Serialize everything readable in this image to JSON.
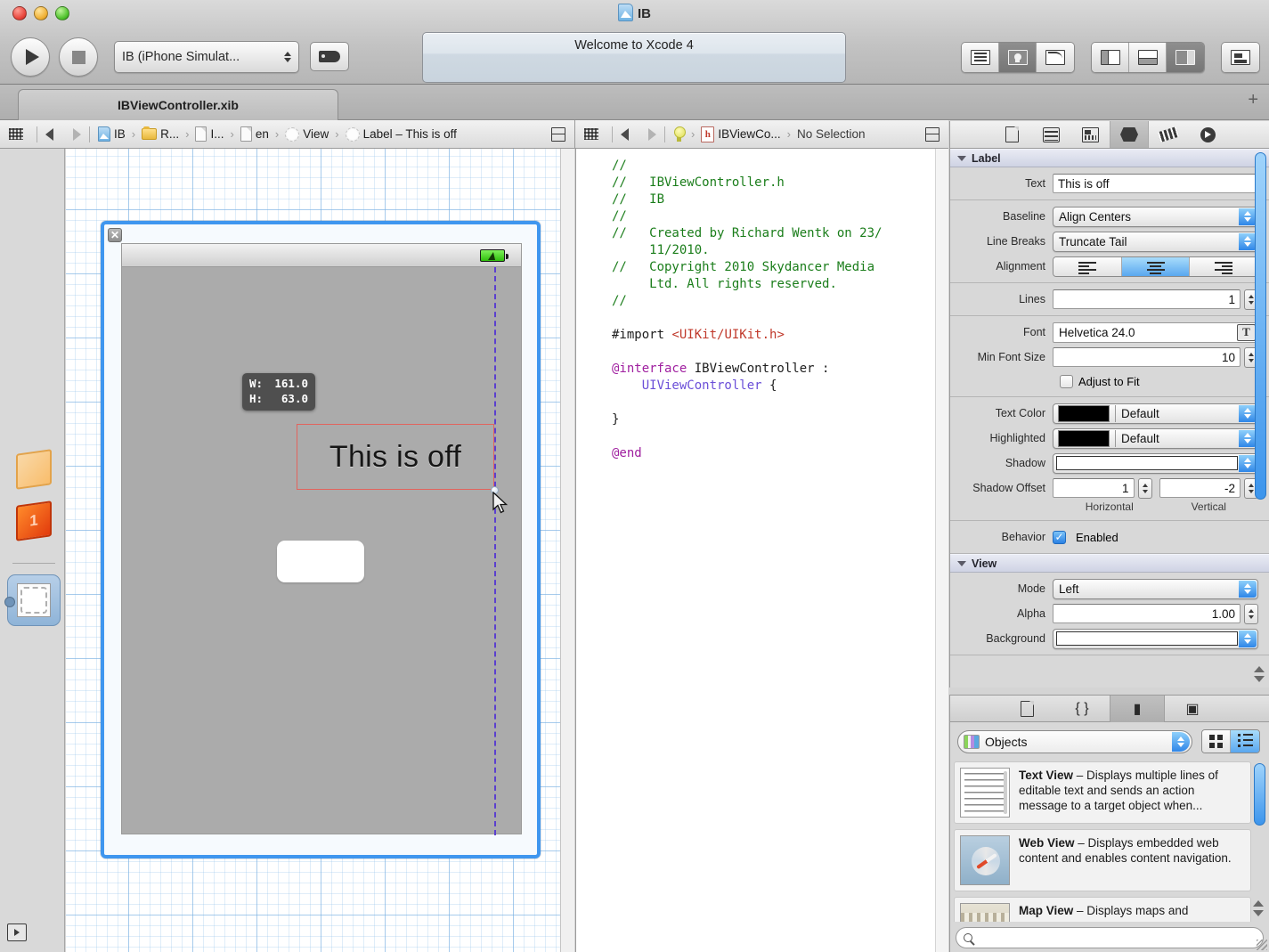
{
  "window": {
    "title": "IB",
    "title_icon": "xcode-project-icon",
    "traffic_lights": [
      "close",
      "minimize",
      "zoom"
    ]
  },
  "toolbar": {
    "run_button": "run-icon",
    "stop_button": "stop-icon",
    "scheme": "IB (iPhone Simulat...",
    "breakpoint_button": "breakpoint-icon",
    "status": "Welcome to Xcode 4",
    "editor_segments": [
      {
        "name": "standard-editor",
        "icon": "lines-icon",
        "selected": false
      },
      {
        "name": "assistant-editor",
        "icon": "bulb-icon",
        "selected": true
      },
      {
        "name": "version-editor",
        "icon": "curve-icon",
        "selected": false
      }
    ],
    "view_segments": [
      {
        "name": "navigator-toggle",
        "icon": "left-pane-icon",
        "selected": false
      },
      {
        "name": "debug-toggle",
        "icon": "bottom-pane-icon",
        "selected": false
      },
      {
        "name": "utilities-toggle",
        "icon": "right-pane-icon",
        "selected": true
      }
    ],
    "organizer_button": "organizer-icon"
  },
  "tabbar": {
    "tab_label": "IBViewController.xib",
    "add_tab": "+"
  },
  "jumpbar_left": {
    "crumbs": [
      {
        "label": "IB",
        "icon": "project-icon"
      },
      {
        "label": "R...",
        "icon": "folder-icon"
      },
      {
        "label": "I...",
        "icon": "file-icon"
      },
      {
        "label": "en",
        "icon": "file-icon"
      },
      {
        "label": "View",
        "icon": "object-icon"
      },
      {
        "label": "Label – This is off",
        "icon": "object-icon"
      }
    ]
  },
  "jumpbar_mid": {
    "crumbs": [
      {
        "label": "",
        "icon": "bulb-icon"
      },
      {
        "label": "IBViewCo...",
        "icon": "header-file-icon"
      },
      {
        "label": "No Selection",
        "icon": ""
      }
    ]
  },
  "canvas": {
    "size_tooltip": {
      "w_key": "W:",
      "w_value": "161.0",
      "h_key": "H:",
      "h_value": "63.0"
    },
    "label_text": "This is off",
    "close_glyph": "✕",
    "battery_icon": "battery-charging-icon"
  },
  "editor": {
    "lines": [
      [
        {
          "t": "//",
          "c": "comment"
        }
      ],
      [
        {
          "t": "//   IBViewController.h",
          "c": "comment"
        }
      ],
      [
        {
          "t": "//   IB",
          "c": "comment"
        }
      ],
      [
        {
          "t": "//",
          "c": "comment"
        }
      ],
      [
        {
          "t": "//   Created by Richard Wentk on 23/",
          "c": "comment"
        }
      ],
      [
        {
          "t": "     11/2010.",
          "c": "comment"
        }
      ],
      [
        {
          "t": "//   Copyright 2010 Skydancer Media",
          "c": "comment"
        }
      ],
      [
        {
          "t": "     Ltd. All rights reserved.",
          "c": "comment"
        }
      ],
      [
        {
          "t": "//",
          "c": "comment"
        }
      ],
      [
        {
          "t": "",
          "c": "plain"
        }
      ],
      [
        {
          "t": "#import ",
          "c": "pre"
        },
        {
          "t": "<UIKit/UIKit.h>",
          "c": "str"
        }
      ],
      [
        {
          "t": "",
          "c": "plain"
        }
      ],
      [
        {
          "t": "@interface ",
          "c": "kw"
        },
        {
          "t": "IBViewController ",
          "c": "plain"
        },
        {
          "t": ":",
          "c": "plain"
        }
      ],
      [
        {
          "t": "    UIViewController ",
          "c": "type"
        },
        {
          "t": "{",
          "c": "plain"
        }
      ],
      [
        {
          "t": "",
          "c": "plain"
        }
      ],
      [
        {
          "t": "}",
          "c": "plain"
        }
      ],
      [
        {
          "t": "",
          "c": "plain"
        }
      ],
      [
        {
          "t": "@end",
          "c": "kw"
        }
      ]
    ]
  },
  "inspector": {
    "tabs": [
      {
        "name": "file-inspector",
        "icon": "document-icon",
        "selected": false
      },
      {
        "name": "quick-help-inspector",
        "icon": "wave-icon",
        "selected": false
      },
      {
        "name": "identity-inspector",
        "icon": "id-card-icon",
        "selected": false
      },
      {
        "name": "attributes-inspector",
        "icon": "shield-icon",
        "selected": true
      },
      {
        "name": "size-inspector",
        "icon": "ruler-icon",
        "selected": false
      },
      {
        "name": "connections-inspector",
        "icon": "arrow-circle-icon",
        "selected": false
      }
    ],
    "label_section": {
      "title": "Label",
      "text_label": "Text",
      "text_value": "This is off",
      "baseline_label": "Baseline",
      "baseline_value": "Align Centers",
      "linebreaks_label": "Line Breaks",
      "linebreaks_value": "Truncate Tail",
      "alignment_label": "Alignment",
      "alignment_selected": "center",
      "lines_label": "Lines",
      "lines_value": "1",
      "font_label": "Font",
      "font_value": "Helvetica 24.0",
      "font_button_glyph": "T",
      "minfont_label": "Min Font Size",
      "minfont_value": "10",
      "adjust_label": "Adjust to Fit",
      "adjust_checked": false,
      "textcolor_label": "Text Color",
      "textcolor_value": "Default",
      "textcolor_swatch": "#000000",
      "highlighted_label": "Highlighted",
      "highlighted_value": "Default",
      "highlighted_swatch": "#000000",
      "shadow_label": "Shadow",
      "shadow_swatch": "#ffffff",
      "shadowoffset_label": "Shadow Offset",
      "shadow_h_value": "1",
      "shadow_v_value": "-2",
      "shadow_h_caption": "Horizontal",
      "shadow_v_caption": "Vertical",
      "behavior_label": "Behavior",
      "behavior_value": "Enabled",
      "behavior_checked": true
    },
    "view_section": {
      "title": "View",
      "mode_label": "Mode",
      "mode_value": "Left",
      "alpha_label": "Alpha",
      "alpha_value": "1.00",
      "background_label": "Background",
      "background_swatch": "#ffffff"
    }
  },
  "library": {
    "tabs": [
      {
        "name": "file-template-library",
        "glyph": "document-icon",
        "selected": false
      },
      {
        "name": "code-snippet-library",
        "glyph": "braces-icon",
        "selected": false
      },
      {
        "name": "object-library",
        "glyph": "cube-icon",
        "selected": true
      },
      {
        "name": "media-library",
        "glyph": "film-icon",
        "selected": false
      }
    ],
    "popup_value": "Objects",
    "view_modes": [
      {
        "name": "grid-view",
        "icon": "grid-icon",
        "selected": false
      },
      {
        "name": "list-view",
        "icon": "list-icon",
        "selected": true
      }
    ],
    "items": [
      {
        "name": "Text View",
        "desc": " – Displays multiple lines of editable text and sends an action message to a target object when...",
        "thumb": "text"
      },
      {
        "name": "Web View",
        "desc": " – Displays embedded web content and enables content navigation.",
        "thumb": "web"
      },
      {
        "name": "Map View",
        "desc": " – Displays maps and",
        "thumb": "map"
      }
    ],
    "search_placeholder": ""
  },
  "leftbar": {
    "items": [
      {
        "name": "placeholders-wireframe-cube",
        "selected": false
      },
      {
        "name": "objects-solid-cube",
        "selected": false
      },
      {
        "name": "view-object-selected",
        "selected": true
      }
    ],
    "bottom_button": "show-hide-panel-icon"
  },
  "colors": {
    "selection_blue": "#3f96ef",
    "label_outline_red": "#e2635d",
    "guide_purple": "#5b3fcf",
    "comment_green": "#1a7d1a",
    "string_red": "#c0392b",
    "keyword_magenta": "#a020a0",
    "type_purple": "#6b4fd8"
  }
}
